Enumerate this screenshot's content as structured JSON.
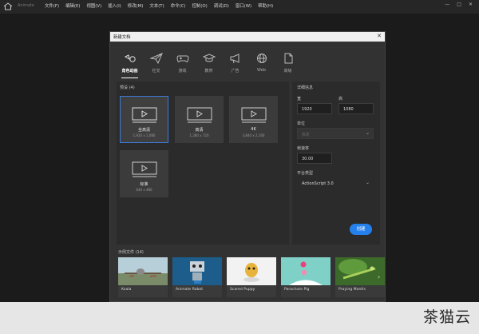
{
  "app": {
    "workspace_label": "Animate",
    "menu": [
      "文件(F)",
      "编辑(E)",
      "视图(V)",
      "插入(I)",
      "修改(M)",
      "文本(T)",
      "命令(C)",
      "控制(O)",
      "调试(D)",
      "窗口(W)",
      "帮助(H)"
    ],
    "window_controls": [
      "—",
      "□",
      "✕"
    ]
  },
  "dialog": {
    "title": "新建文档",
    "close": "✕",
    "categories": [
      {
        "label": "角色动画",
        "icon": "character-animation-icon",
        "active": true
      },
      {
        "label": "社交",
        "icon": "paper-plane-icon",
        "active": false
      },
      {
        "label": "游戏",
        "icon": "gamepad-icon",
        "active": false
      },
      {
        "label": "教育",
        "icon": "graduation-cap-icon",
        "active": false
      },
      {
        "label": "广告",
        "icon": "megaphone-icon",
        "active": false
      },
      {
        "label": "Web",
        "icon": "globe-icon",
        "active": false
      },
      {
        "label": "高级",
        "icon": "document-icon",
        "active": false
      }
    ],
    "presets_label": "预设 (4)",
    "presets": [
      {
        "name": "全高清",
        "size": "1,920 x 1,080",
        "selected": true
      },
      {
        "name": "高清",
        "size": "1,280 x 720",
        "selected": false
      },
      {
        "name": "4K",
        "size": "3,840 x 2,160",
        "selected": false
      },
      {
        "name": "标准",
        "size": "640 x 480",
        "selected": false
      }
    ],
    "details": {
      "title": "详细信息",
      "width_label": "宽",
      "width_value": "1920",
      "height_label": "高",
      "height_value": "1080",
      "units_label": "单位",
      "units_value": "像素",
      "fps_label": "帧速率",
      "fps_value": "30.00",
      "platform_label": "平台类型",
      "platform_value": "ActionScript 3.0"
    },
    "create_label": "创建",
    "samples_label": "示例文件 (14)",
    "samples": [
      "Koala",
      "Animate Robot",
      "Scared Puppy",
      "Parachute Pig",
      "Praying Mantis"
    ]
  },
  "watermark": "茶猫云",
  "colors": {
    "accent": "#2680eb",
    "selected_border": "#3d7bd9"
  }
}
